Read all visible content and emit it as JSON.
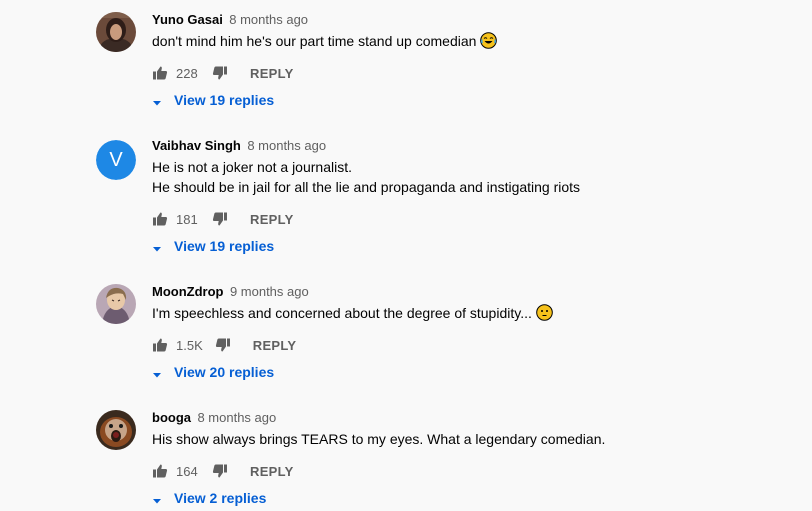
{
  "accent_color": "#065fd4",
  "comments": [
    {
      "author": "Yuno Gasai",
      "time": "8 months ago",
      "lines": [
        "don't mind him he's our part time stand up comedian"
      ],
      "emoji": "face-with-tears-of-joy-icon",
      "likes": "228",
      "reply_label": "REPLY",
      "view_replies": "View 19 replies",
      "avatar": "photo-avatar"
    },
    {
      "author": "Vaibhav Singh",
      "time": "8 months ago",
      "lines": [
        "He is not a joker not a journalist.",
        "He should be in jail for all the lie and propaganda and instigating riots"
      ],
      "likes": "181",
      "reply_label": "REPLY",
      "view_replies": "View 19 replies",
      "avatar_letter": "V",
      "avatar_color": "#1e88e5"
    },
    {
      "author": "MoonZdrop",
      "time": "9 months ago",
      "lines": [
        "I'm speechless and concerned about the degree of stupidity..."
      ],
      "emoji": "flushed-face-icon",
      "likes": "1.5K",
      "reply_label": "REPLY",
      "view_replies": "View 20 replies",
      "avatar": "drawing-avatar"
    },
    {
      "author": "booga",
      "time": "8 months ago",
      "lines": [
        "His show always brings TEARS to my eyes. What a legendary comedian."
      ],
      "likes": "164",
      "reply_label": "REPLY",
      "view_replies": "View 2 replies",
      "avatar": "orangutan-avatar"
    }
  ]
}
